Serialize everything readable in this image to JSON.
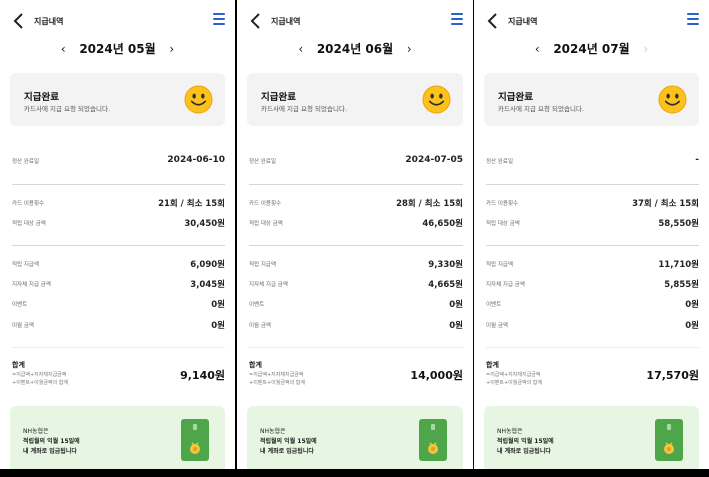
{
  "colors": {
    "accent": "#2a62c9",
    "status_box_bg": "#f3f3f4",
    "promo_bg": "#e6f6e2",
    "card_green": "#4fa64a"
  },
  "labels": {
    "page_title": "지급내역",
    "status_title": "지급완료",
    "status_desc": "카드사에 지급 요청 되었습니다.",
    "settlement_date": "정산 완료일",
    "card_uses": "카드 이용횟수",
    "accum_target": "적립 대상 금액",
    "accum_pay": "적립 지급액",
    "local_pay": "지자체 지급 금액",
    "event": "이벤트",
    "carryover": "이월 금액",
    "total_title": "합계",
    "total_formula_1": "=지급액+지자체지급금액",
    "total_formula_2": "+이벤트+이월금액의 합계",
    "promo_line_1": "NH농협은",
    "promo_line_2": "적립월의 익월 15일에",
    "promo_line_3": "내 계좌로 입금됩니다"
  },
  "icons": {
    "back": "chevron-left-icon",
    "menu": "hamburger-menu-icon",
    "prev": "chevron-left-icon",
    "next": "chevron-right-icon",
    "status": "smiley-face-icon",
    "card": "green-card-icon"
  },
  "screens": [
    {
      "month": "2024년 05월",
      "next_enabled": true,
      "settlement_date": "2024-06-10",
      "card_uses": "21회 / 최소 15회",
      "accum_target": "30,450원",
      "accum_pay": "6,090원",
      "local_pay": "3,045원",
      "event": "0원",
      "carryover": "0원",
      "total": "9,140원"
    },
    {
      "month": "2024년 06월",
      "next_enabled": true,
      "settlement_date": "2024-07-05",
      "card_uses": "28회 / 최소 15회",
      "accum_target": "46,650원",
      "accum_pay": "9,330원",
      "local_pay": "4,665원",
      "event": "0원",
      "carryover": "0원",
      "total": "14,000원"
    },
    {
      "month": "2024년 07월",
      "next_enabled": false,
      "settlement_date": "-",
      "card_uses": "37회 / 최소 15회",
      "accum_target": "58,550원",
      "accum_pay": "11,710원",
      "local_pay": "5,855원",
      "event": "0원",
      "carryover": "0원",
      "total": "17,570원"
    }
  ]
}
